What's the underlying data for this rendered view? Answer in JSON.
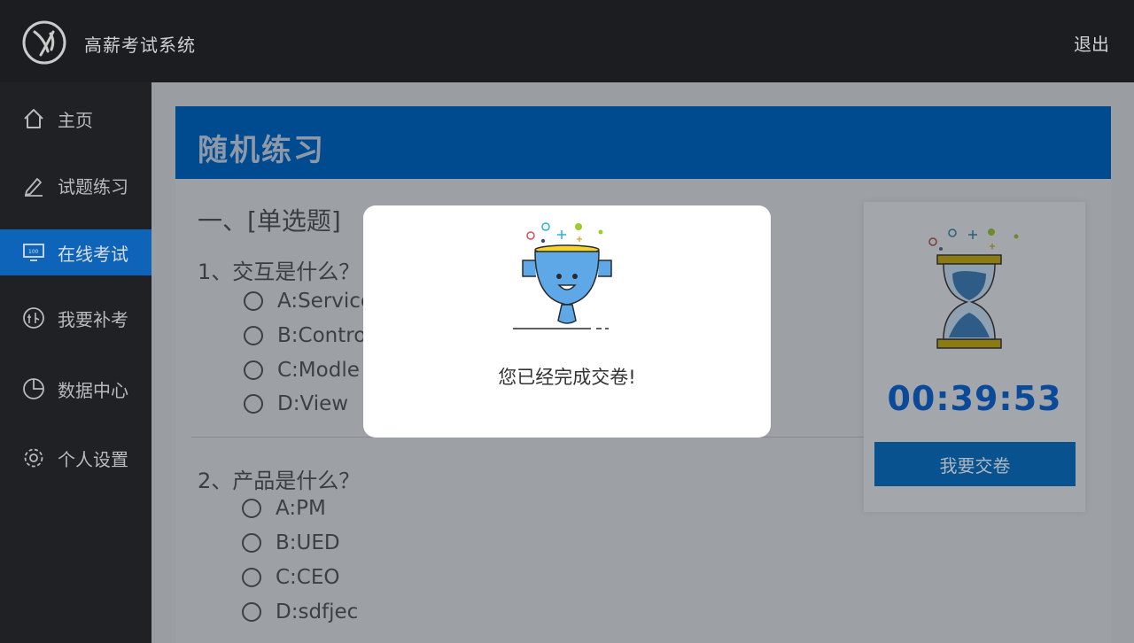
{
  "app": {
    "title": "高薪考试系统",
    "logout": "退出"
  },
  "sidebar": {
    "items": [
      {
        "label": "主页",
        "icon": "home-icon"
      },
      {
        "label": "试题练习",
        "icon": "pencil-icon"
      },
      {
        "label": "在线考试",
        "icon": "monitor-icon",
        "active": true
      },
      {
        "label": "我要补考",
        "icon": "makeup-icon"
      },
      {
        "label": "数据中心",
        "icon": "pie-chart-icon"
      },
      {
        "label": "个人设置",
        "icon": "gear-icon"
      }
    ]
  },
  "panel": {
    "title": "随机练习"
  },
  "section": {
    "title": "一、[单选题]"
  },
  "questions": [
    {
      "text": "1、交互是什么？",
      "options": [
        "A:Service",
        "B:Contro",
        "C:Modle",
        "D:View"
      ]
    },
    {
      "text": "2、产品是什么？",
      "options": [
        "A:PM",
        "B:UED",
        "C:CEO",
        "D:sdfjec"
      ]
    }
  ],
  "timer": {
    "time": "00:39:53",
    "submit_label": "我要交卷"
  },
  "modal": {
    "message": "您已经完成交卷!"
  },
  "colors": {
    "topbar": "#1c1d21",
    "sidebar": "#1f2124",
    "active": "#0e64b8",
    "header": "#004a8f",
    "timer": "#0a4a98"
  }
}
